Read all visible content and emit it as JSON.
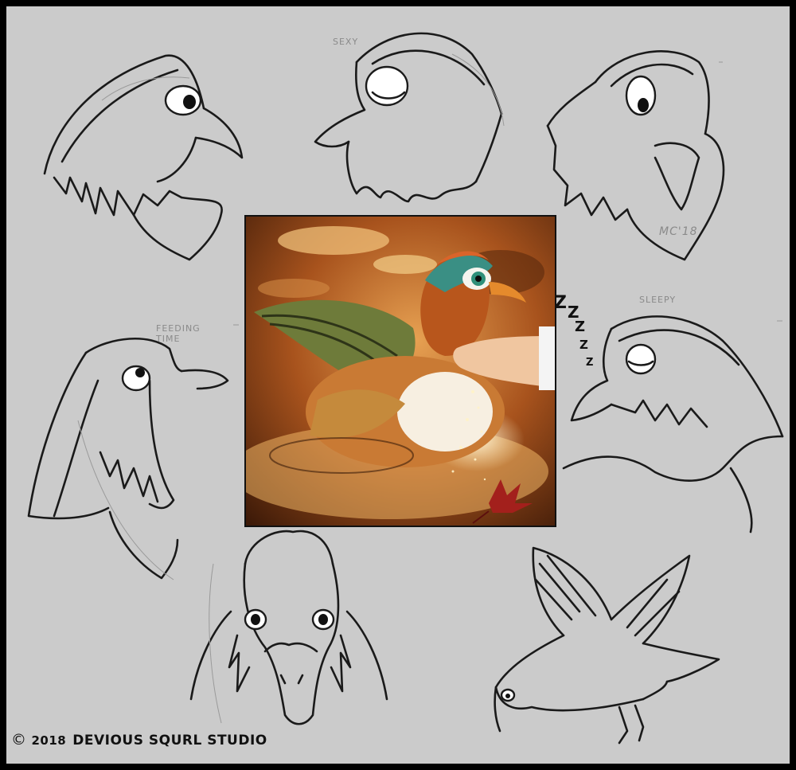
{
  "labels": {
    "sexy": "SEXY",
    "feeding_time": "FEEDING\nTIME",
    "sleepy": "SLEEPY",
    "signature": "MC'18"
  },
  "zzz": [
    "Z",
    "Z",
    "Z",
    "Z",
    "Z"
  ],
  "credit": {
    "symbol": "©",
    "year": "2018",
    "studio": "DEVIOUS SQURL STUDIO"
  },
  "colors": {
    "frame": "#000000",
    "paper": "#cbcbcb",
    "ink": "#1a1a1a",
    "pencil": "#9a9a9a"
  }
}
